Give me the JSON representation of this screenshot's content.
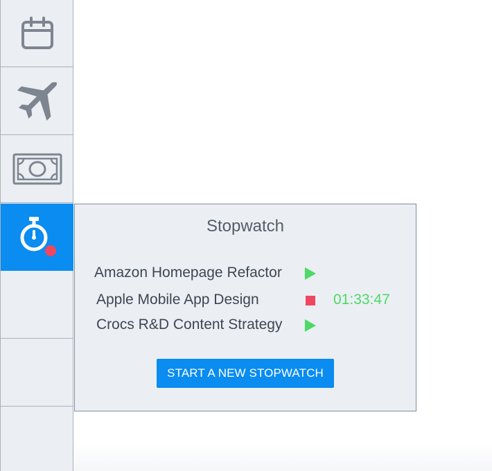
{
  "sidebar": {
    "items": [
      {
        "icon": "calendar-icon",
        "active": false
      },
      {
        "icon": "airplane-icon",
        "active": false
      },
      {
        "icon": "money-icon",
        "active": false
      },
      {
        "icon": "stopwatch-icon",
        "active": true,
        "has_notification": true
      }
    ]
  },
  "stopwatch_panel": {
    "title": "Stopwatch",
    "entries": [
      {
        "name": "Amazon Homepage Refactor",
        "status": "stopped",
        "action": "play",
        "elapsed": ""
      },
      {
        "name": "Apple Mobile App Design",
        "status": "running",
        "action": "stop",
        "elapsed": "01:33:47"
      },
      {
        "name": "Crocs R&D Content Strategy",
        "status": "stopped",
        "action": "play",
        "elapsed": ""
      }
    ],
    "new_button_label": "START A NEW STOPWATCH"
  },
  "colors": {
    "accent": "#0a8cf0",
    "play": "#4cd964",
    "stop": "#ef4760",
    "timer": "#4cd964",
    "icon_gray": "#7d8590",
    "sidebar_bg": "#ebeef2",
    "panel_bg": "#ebeff4"
  }
}
